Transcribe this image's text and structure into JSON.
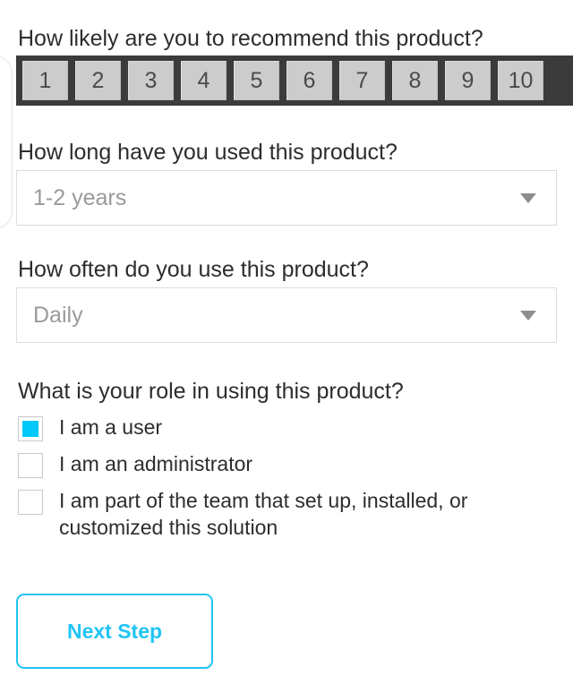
{
  "theme": {
    "accent": "#21c4f5",
    "checkbox_fill": "#00c8f8",
    "rating_bar_bg": "#3b3b3b",
    "rating_cell_bg": "#cccccc",
    "text": "#2d2d2d",
    "placeholder_text": "#9a9a9a",
    "field_border": "#dcdcdc"
  },
  "survey": {
    "recommend": {
      "question": "How likely are you to recommend this product?",
      "scale": [
        "1",
        "2",
        "3",
        "4",
        "5",
        "6",
        "7",
        "8",
        "9",
        "10"
      ],
      "selected": null
    },
    "duration": {
      "question": "How long have you used this product?",
      "value": "1-2 years",
      "arrow_icon": "chevron-down-icon"
    },
    "frequency": {
      "question": "How often do you use this product?",
      "value": "Daily",
      "arrow_icon": "chevron-down-icon"
    },
    "role": {
      "question": "What is your role in using this product?",
      "options": [
        {
          "label": "I am a user",
          "checked": true
        },
        {
          "label": "I am an administrator",
          "checked": false
        },
        {
          "label": "I am part of the team that set up, installed, or customized this solution",
          "checked": false
        }
      ]
    },
    "submit_label": "Next Step"
  }
}
